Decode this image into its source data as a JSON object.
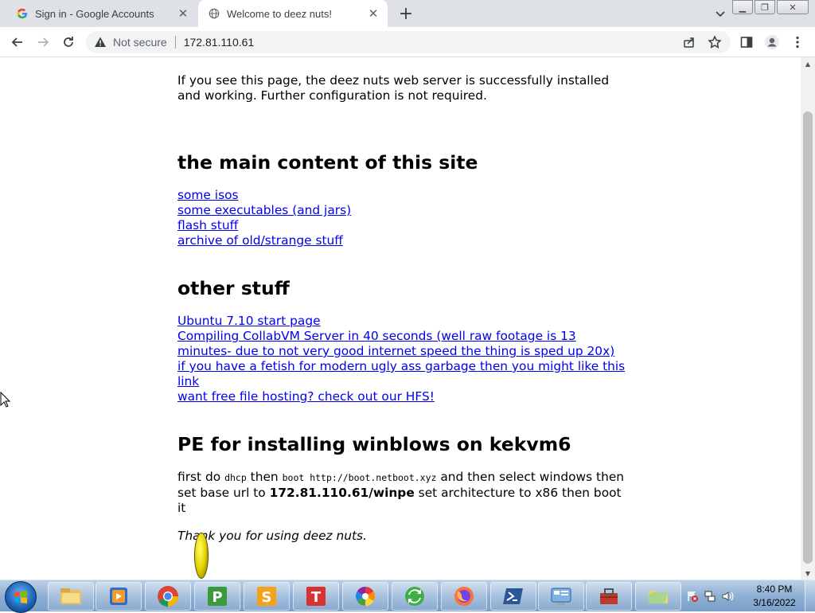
{
  "browser": {
    "tabs": [
      {
        "title": "Sign in - Google Accounts",
        "active": false,
        "icon": "google-g-icon"
      },
      {
        "title": "Welcome to deez nuts!",
        "active": true,
        "icon": "globe-icon"
      }
    ],
    "address": {
      "security_label": "Not secure",
      "url": "172.81.110.61"
    }
  },
  "page": {
    "intro": "If you see this page, the deez nuts web server is successfully installed and working. Further configuration is not required.",
    "section_main": {
      "heading": "the main content of this site",
      "links": [
        "some isos",
        "some executables (and jars)",
        "flash stuff",
        "archive of old/strange stuff"
      ]
    },
    "section_other": {
      "heading": "other stuff",
      "links": [
        "Ubuntu 7.10 start page",
        "Compiling CollabVM Server in 40 seconds (well raw footage is 13 minutes- due to not very good internet speed the thing is sped up 20x)",
        "if you have a fetish for modern ugly ass garbage then you might like this link",
        "want free file hosting? check out our HFS!"
      ]
    },
    "section_pe": {
      "heading": "PE for installing winblows on kekvm6",
      "text_1": "first do",
      "code_1": "dhcp",
      "text_2": "then",
      "code_2": "boot http://boot.netboot.xyz",
      "text_3": "and then select windows then set base url to",
      "bold_url": "172.81.110.61/winpe",
      "text_4": "set architecture to x86 then boot it"
    },
    "thanks": "Thank you for using deez nuts."
  },
  "taskbar": {
    "apps": [
      "explorer-icon",
      "media-player-icon",
      "chrome-icon",
      "publisher-icon",
      "sway-icon",
      "t-app-icon",
      "pinwheel-icon",
      "sync-icon",
      "firefox-icon",
      "powershell-icon",
      "control-panel-icon",
      "toolbox-icon",
      "folder-icon"
    ],
    "clock_time": "8:40 PM",
    "clock_date": "3/16/2022"
  }
}
